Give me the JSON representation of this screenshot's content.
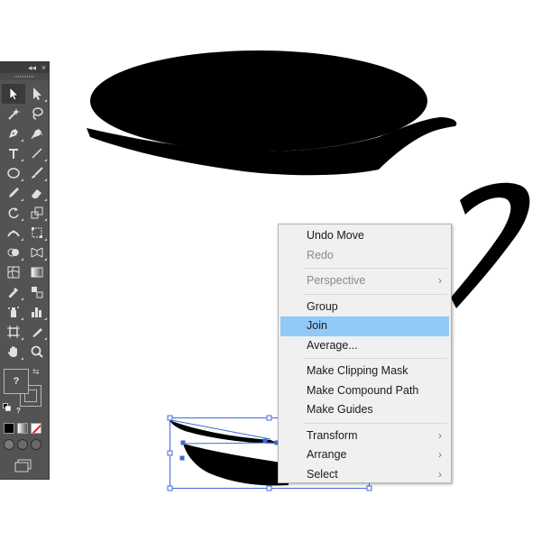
{
  "toolbox": {
    "collapse_glyph": "◂◂",
    "close_glyph": "×",
    "fill_label": "?",
    "stroke_label_1": "?",
    "stroke_label_2": "?",
    "tools": [
      {
        "name": "selection-tool-icon",
        "active": true
      },
      {
        "name": "direct-selection-tool-icon"
      },
      {
        "name": "magic-wand-tool-icon"
      },
      {
        "name": "lasso-tool-icon"
      },
      {
        "name": "pen-tool-icon"
      },
      {
        "name": "curvature-tool-icon"
      },
      {
        "name": "type-tool-icon"
      },
      {
        "name": "line-segment-tool-icon"
      },
      {
        "name": "ellipse-tool-icon"
      },
      {
        "name": "paintbrush-tool-icon"
      },
      {
        "name": "pencil-tool-icon"
      },
      {
        "name": "eraser-tool-icon"
      },
      {
        "name": "rotate-tool-icon"
      },
      {
        "name": "scale-tool-icon"
      },
      {
        "name": "width-tool-icon"
      },
      {
        "name": "free-transform-tool-icon"
      },
      {
        "name": "shape-builder-tool-icon"
      },
      {
        "name": "perspective-grid-tool-icon"
      },
      {
        "name": "mesh-tool-icon"
      },
      {
        "name": "gradient-tool-icon"
      },
      {
        "name": "eyedropper-tool-icon"
      },
      {
        "name": "blend-tool-icon"
      },
      {
        "name": "symbol-sprayer-tool-icon"
      },
      {
        "name": "column-graph-tool-icon"
      },
      {
        "name": "artboard-tool-icon"
      },
      {
        "name": "slice-tool-icon"
      },
      {
        "name": "hand-tool-icon"
      },
      {
        "name": "zoom-tool-icon"
      }
    ]
  },
  "context_menu": {
    "groups": [
      [
        {
          "label": "Undo Move",
          "enabled": true
        },
        {
          "label": "Redo",
          "enabled": false
        }
      ],
      [
        {
          "label": "Perspective",
          "enabled": false,
          "submenu": true
        }
      ],
      [
        {
          "label": "Group",
          "enabled": true
        },
        {
          "label": "Join",
          "enabled": true,
          "highlighted": true
        },
        {
          "label": "Average...",
          "enabled": true
        }
      ],
      [
        {
          "label": "Make Clipping Mask",
          "enabled": true
        },
        {
          "label": "Make Compound Path",
          "enabled": true
        },
        {
          "label": "Make Guides",
          "enabled": true
        }
      ],
      [
        {
          "label": "Transform",
          "enabled": true,
          "submenu": true
        },
        {
          "label": "Arrange",
          "enabled": true,
          "submenu": true
        },
        {
          "label": "Select",
          "enabled": true,
          "submenu": true
        }
      ]
    ],
    "submenu_glyph": "›"
  },
  "colors": {
    "menu_highlight": "#91c9f7",
    "selection_blue": "#3d6ad6",
    "toolbox_bg": "#535353"
  }
}
